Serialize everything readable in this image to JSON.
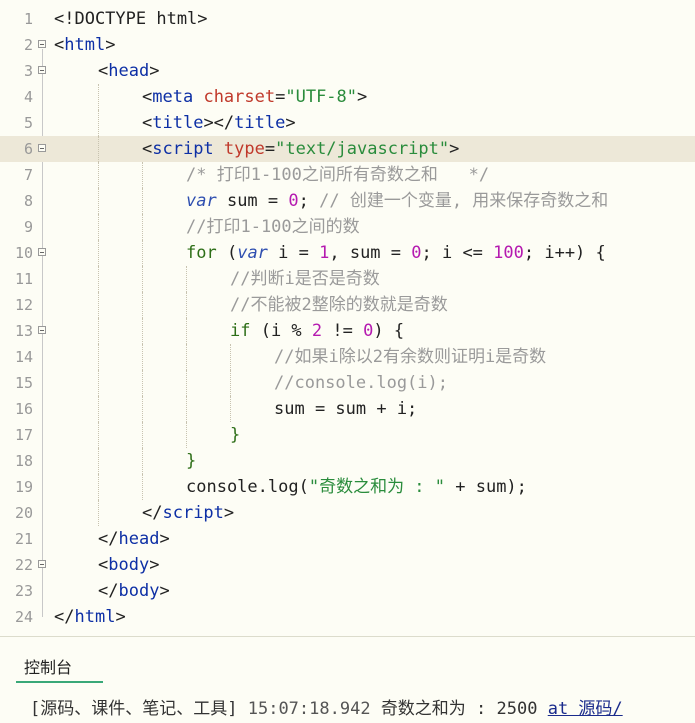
{
  "editor": {
    "active_line": 6,
    "lines": [
      {
        "num": "1",
        "fold": false,
        "indent": 0,
        "tokens": [
          {
            "t": "p",
            "v": "<!DOCTYPE html>"
          }
        ]
      },
      {
        "num": "2",
        "fold": true,
        "indent": 0,
        "tokens": [
          {
            "t": "p",
            "v": "<"
          },
          {
            "t": "tag",
            "v": "html"
          },
          {
            "t": "p",
            "v": ">"
          }
        ]
      },
      {
        "num": "3",
        "fold": true,
        "indent": 1,
        "tokens": [
          {
            "t": "p",
            "v": "<"
          },
          {
            "t": "tag",
            "v": "head"
          },
          {
            "t": "p",
            "v": ">"
          }
        ]
      },
      {
        "num": "4",
        "fold": false,
        "indent": 2,
        "tokens": [
          {
            "t": "p",
            "v": "<"
          },
          {
            "t": "tag",
            "v": "meta"
          },
          {
            "t": "p",
            "v": " "
          },
          {
            "t": "attr",
            "v": "charset"
          },
          {
            "t": "p",
            "v": "="
          },
          {
            "t": "str",
            "v": "\"UTF-8\""
          },
          {
            "t": "p",
            "v": ">"
          }
        ]
      },
      {
        "num": "5",
        "fold": false,
        "indent": 2,
        "tokens": [
          {
            "t": "p",
            "v": "<"
          },
          {
            "t": "tag",
            "v": "title"
          },
          {
            "t": "p",
            "v": "></"
          },
          {
            "t": "tag",
            "v": "title"
          },
          {
            "t": "p",
            "v": ">"
          }
        ]
      },
      {
        "num": "6",
        "fold": true,
        "indent": 2,
        "tokens": [
          {
            "t": "p",
            "v": "<"
          },
          {
            "t": "tag",
            "v": "script"
          },
          {
            "t": "p",
            "v": " "
          },
          {
            "t": "attr",
            "v": "type"
          },
          {
            "t": "p",
            "v": "="
          },
          {
            "t": "str",
            "v": "\"text/javascript\""
          },
          {
            "t": "p",
            "v": ">"
          }
        ]
      },
      {
        "num": "7",
        "fold": false,
        "indent": 3,
        "tokens": [
          {
            "t": "cmt",
            "v": "/* 打印1-100之间所有奇数之和   */"
          }
        ]
      },
      {
        "num": "8",
        "fold": false,
        "indent": 3,
        "tokens": [
          {
            "t": "var",
            "v": "var"
          },
          {
            "t": "p",
            "v": " sum = "
          },
          {
            "t": "num",
            "v": "0"
          },
          {
            "t": "p",
            "v": "; "
          },
          {
            "t": "cmt",
            "v": "// 创建一个变量, 用来保存奇数之和"
          }
        ]
      },
      {
        "num": "9",
        "fold": false,
        "indent": 3,
        "tokens": [
          {
            "t": "cmt",
            "v": "//打印1-100之间的数"
          }
        ]
      },
      {
        "num": "10",
        "fold": true,
        "indent": 3,
        "tokens": [
          {
            "t": "kw",
            "v": "for"
          },
          {
            "t": "p",
            "v": " ("
          },
          {
            "t": "var",
            "v": "var"
          },
          {
            "t": "p",
            "v": " i = "
          },
          {
            "t": "num",
            "v": "1"
          },
          {
            "t": "p",
            "v": ", sum = "
          },
          {
            "t": "num",
            "v": "0"
          },
          {
            "t": "p",
            "v": "; i <= "
          },
          {
            "t": "num",
            "v": "100"
          },
          {
            "t": "p",
            "v": "; i++) {"
          }
        ]
      },
      {
        "num": "11",
        "fold": false,
        "indent": 4,
        "tokens": [
          {
            "t": "cmt",
            "v": "//判断i是否是奇数"
          }
        ]
      },
      {
        "num": "12",
        "fold": false,
        "indent": 4,
        "tokens": [
          {
            "t": "cmt",
            "v": "//不能被2整除的数就是奇数"
          }
        ]
      },
      {
        "num": "13",
        "fold": true,
        "indent": 4,
        "tokens": [
          {
            "t": "kw",
            "v": "if"
          },
          {
            "t": "p",
            "v": " (i % "
          },
          {
            "t": "num",
            "v": "2"
          },
          {
            "t": "p",
            "v": " != "
          },
          {
            "t": "num",
            "v": "0"
          },
          {
            "t": "p",
            "v": ") {"
          }
        ]
      },
      {
        "num": "14",
        "fold": false,
        "indent": 5,
        "tokens": [
          {
            "t": "cmt",
            "v": "//如果i除以2有余数则证明i是奇数"
          }
        ]
      },
      {
        "num": "15",
        "fold": false,
        "indent": 5,
        "tokens": [
          {
            "t": "cmt",
            "v": "//console.log(i);"
          }
        ]
      },
      {
        "num": "16",
        "fold": false,
        "indent": 5,
        "tokens": [
          {
            "t": "p",
            "v": "sum = sum + i;"
          }
        ]
      },
      {
        "num": "17",
        "fold": false,
        "indent": 4,
        "tokens": [
          {
            "t": "kw",
            "v": "}"
          }
        ]
      },
      {
        "num": "18",
        "fold": false,
        "indent": 3,
        "tokens": [
          {
            "t": "kw",
            "v": "}"
          }
        ]
      },
      {
        "num": "19",
        "fold": false,
        "indent": 3,
        "tokens": [
          {
            "t": "p",
            "v": "console.log("
          },
          {
            "t": "str",
            "v": "\"奇数之和为 : \""
          },
          {
            "t": "p",
            "v": " + sum);"
          }
        ]
      },
      {
        "num": "20",
        "fold": false,
        "indent": 2,
        "tokens": [
          {
            "t": "p",
            "v": "</"
          },
          {
            "t": "tag",
            "v": "script"
          },
          {
            "t": "p",
            "v": ">"
          }
        ]
      },
      {
        "num": "21",
        "fold": false,
        "indent": 1,
        "tokens": [
          {
            "t": "p",
            "v": "</"
          },
          {
            "t": "tag",
            "v": "head"
          },
          {
            "t": "p",
            "v": ">"
          }
        ]
      },
      {
        "num": "22",
        "fold": true,
        "indent": 1,
        "tokens": [
          {
            "t": "p",
            "v": "<"
          },
          {
            "t": "tag",
            "v": "body"
          },
          {
            "t": "p",
            "v": ">"
          }
        ]
      },
      {
        "num": "23",
        "fold": false,
        "indent": 1,
        "tokens": [
          {
            "t": "p",
            "v": "</"
          },
          {
            "t": "tag",
            "v": "body"
          },
          {
            "t": "p",
            "v": ">"
          }
        ]
      },
      {
        "num": "24",
        "fold": false,
        "indent": 0,
        "tokens": [
          {
            "t": "p",
            "v": "</"
          },
          {
            "t": "tag",
            "v": "html"
          },
          {
            "t": "p",
            "v": ">"
          }
        ]
      }
    ]
  },
  "console": {
    "tab_label": "控制台",
    "output": {
      "source": "[源码、课件、笔记、工具]",
      "timestamp": "15:07:18.942",
      "message": "奇数之和为 : 2500",
      "at_label": "at 源码/"
    }
  },
  "colors": {
    "background": "#fdfdf5",
    "active_line": "#ede8d8",
    "tag": "#0d2fa5",
    "attr": "#c0392b",
    "string": "#2a8c3c",
    "keyword": "#2d6e17",
    "number": "#b51ab0",
    "comment": "#9a9a9a",
    "console_tab_underline": "#39a878"
  }
}
